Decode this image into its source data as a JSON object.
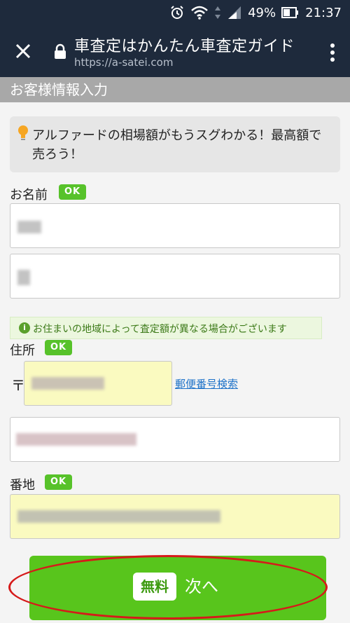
{
  "status_bar": {
    "battery": "49%",
    "time": "21:37"
  },
  "browser": {
    "title": "車査定はかんたん車査定ガイド",
    "url": "https://a-satei.com"
  },
  "page": {
    "title": "お客様情報入力",
    "promo": "アルファードの相場額がもうスグわかる！最高額で売ろう！",
    "name_label": "お名前",
    "name_ok": "OK",
    "notice": "お住まいの地域によって査定額が異なる場合がございます",
    "address_label": "住所",
    "address_ok": "OK",
    "postal_mark": "〒",
    "zip_search_link": "郵便番号検索",
    "block_label": "番地",
    "block_ok": "OK",
    "free_badge": "無料",
    "next_label": "次へ"
  },
  "colors": {
    "toolbar": "#1e2a3c",
    "ok_green": "#57c22a",
    "button_green": "#58c51c",
    "highlight_red": "#d61a1a",
    "field_yellow": "#fafac0"
  }
}
